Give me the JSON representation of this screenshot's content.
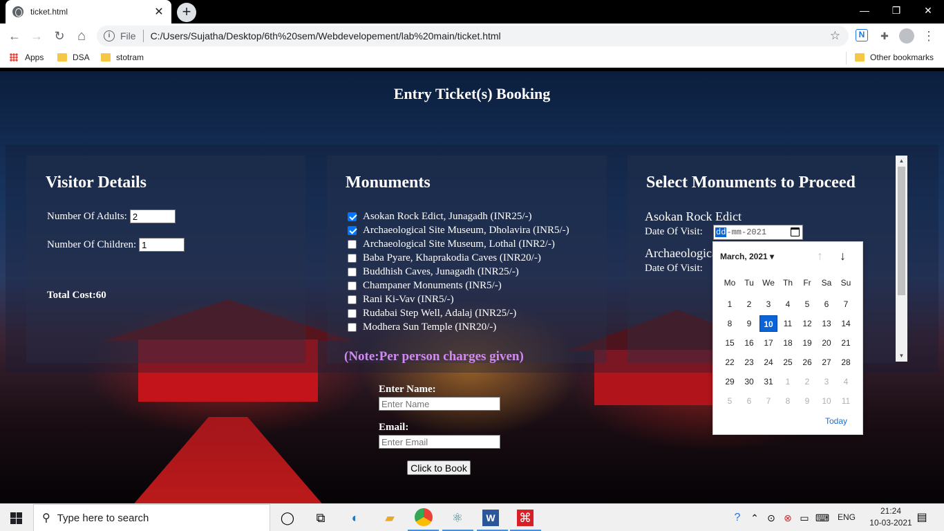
{
  "browser": {
    "tab_title": "ticket.html",
    "tab_close": "✕",
    "new_tab": "+",
    "window_controls": {
      "minimize": "—",
      "restore": "❐",
      "close": "✕"
    },
    "nav": {
      "back": "←",
      "forward": "→",
      "reload": "↻",
      "home": "⌂"
    },
    "address": {
      "info": "i",
      "scheme_label": "File",
      "url": "C:/Users/Sujatha/Desktop/6th%20sem/Webdevelopement/lab%20main/ticket.html",
      "star": "☆"
    },
    "extensions": {
      "n_ext": "N",
      "puzzle": "✚",
      "menu": "⋮"
    },
    "bookmarks": {
      "apps": "Apps",
      "items": [
        "DSA",
        "stotram"
      ],
      "other": "Other bookmarks"
    }
  },
  "page": {
    "title": "Entry Ticket(s) Booking",
    "visitor": {
      "heading": "Visitor Details",
      "adults_label": "Number Of Adults:",
      "adults_value": "2",
      "children_label": "Number Of Children:",
      "children_value": "1",
      "total_label": "Total Cost:60"
    },
    "monuments": {
      "heading": "Monuments",
      "items": [
        {
          "label": "Asokan Rock Edict, Junagadh (INR25/-)",
          "checked": true
        },
        {
          "label": "Archaeological Site Museum, Dholavira (INR5/-)",
          "checked": true
        },
        {
          "label": "Archaeological Site Museum, Lothal (INR2/-)",
          "checked": false
        },
        {
          "label": "Baba Pyare, Khaprakodia Caves (INR20/-)",
          "checked": false
        },
        {
          "label": "Buddhish Caves, Junagadh (INR25/-)",
          "checked": false
        },
        {
          "label": "Champaner Monuments (INR5/-)",
          "checked": false
        },
        {
          "label": "Rani Ki-Vav (INR5/-)",
          "checked": false
        },
        {
          "label": "Rudabai Step Well, Adalaj (INR25/-)",
          "checked": false
        },
        {
          "label": "Modhera Sun Temple (INR20/-)",
          "checked": false
        }
      ],
      "note": "(Note:Per person charges given)"
    },
    "selected": {
      "heading": "Select Monuments to Proceed",
      "first_name": "Asokan Rock Edict",
      "first_date_label": "Date Of Visit:",
      "second_name": "Archaeological Site Museum",
      "second_date_label": "Date Of Visit:",
      "date_input": {
        "day": "dd",
        "month": "mm",
        "year": "2021"
      }
    },
    "form": {
      "name_label": "Enter Name:",
      "name_placeholder": "Enter Name",
      "email_label": "Email:",
      "email_placeholder": "Email",
      "email_placeholder_full": "Enter Email",
      "book_button": "Click to Book"
    }
  },
  "date_picker": {
    "month_label": "March, 2021 ▾",
    "up": "↑",
    "down": "↓",
    "weekdays": [
      "Mo",
      "Tu",
      "We",
      "Th",
      "Fr",
      "Sa",
      "Su"
    ],
    "weeks": [
      [
        "1",
        "2",
        "3",
        "4",
        "5",
        "6",
        "7"
      ],
      [
        "8",
        "9",
        "10",
        "11",
        "12",
        "13",
        "14"
      ],
      [
        "15",
        "16",
        "17",
        "18",
        "19",
        "20",
        "21"
      ],
      [
        "22",
        "23",
        "24",
        "25",
        "26",
        "27",
        "28"
      ],
      [
        "29",
        "30",
        "31",
        "1",
        "2",
        "3",
        "4"
      ],
      [
        "5",
        "6",
        "7",
        "8",
        "9",
        "10",
        "11"
      ]
    ],
    "selected_day": "10",
    "today": "Today"
  },
  "taskbar": {
    "search_placeholder": "Type here to search",
    "language": "ENG",
    "time": "21:24",
    "date": "10-03-2021",
    "word_letter": "W"
  }
}
